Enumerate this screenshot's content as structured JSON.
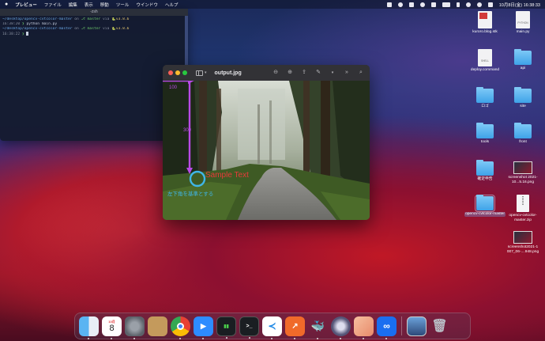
{
  "menubar": {
    "apple": "",
    "app_name": "プレビュー",
    "items": [
      "ファイル",
      "編集",
      "表示",
      "移動",
      "ツール",
      "ウインドウ",
      "ヘルプ"
    ],
    "datetime": "10月8日(金)  16:38:33"
  },
  "terminal": {
    "title": "-zsh",
    "lines": [
      {
        "path": "~/desktop/opencv-cvtcolor-master",
        "on": " on ",
        "branch": "master",
        "via": " via ",
        "py": "v3.8.6"
      },
      {
        "time": "16:38:20",
        "cmd": "python main.py"
      },
      {
        "path": "~/desktop/opencv-cvtcolor-master",
        "on": " on ",
        "branch": "master",
        "via": " via ",
        "py": "v3.8.6"
      },
      {
        "time": "16:38:22",
        "cmd": ""
      }
    ]
  },
  "preview": {
    "title": "output.jpg",
    "overlay": {
      "label_100": "100",
      "label_300": "300",
      "sample_text": "Sample Text",
      "caption": "左下角を基準とする"
    }
  },
  "desktop": {
    "icons": [
      {
        "label": "kuroro.blog.stk",
        "kind": "doc-red"
      },
      {
        "label": "main.py",
        "kind": "doc",
        "tag": "PYTHON"
      },
      {
        "label": "deploy.command",
        "kind": "doc",
        "tag": "SHELL"
      },
      {
        "label": "api",
        "kind": "folder"
      },
      {
        "label": "ロゴ",
        "kind": "folder"
      },
      {
        "label": "site",
        "kind": "folder"
      },
      {
        "label": "tools",
        "kind": "folder"
      },
      {
        "label": "front",
        "kind": "folder"
      },
      {
        "label": "確定申告",
        "kind": "folder"
      },
      {
        "label": "screenshot 2021-10...5.16.png",
        "kind": "shot"
      },
      {
        "label": "opencv-cvtcolor-master",
        "kind": "folder-selected"
      },
      {
        "label": "opencv-cvtcolor-master.zip",
        "kind": "zip"
      },
      {
        "label": "screenshot2021-1 007_06-....948.png",
        "kind": "shot"
      }
    ]
  },
  "dock": {
    "calendar_month": "10月",
    "calendar_day": "8",
    "apps": [
      "finder",
      "calendar",
      "system-preferences",
      "contacts",
      "chrome",
      "zoom",
      "terminal-activity",
      "terminal",
      "vscode",
      "git-tool",
      "docker",
      "disk-utility",
      "preview",
      "infinity-app",
      "downloads",
      "trash"
    ]
  },
  "colors": {
    "overlay_magenta": "#b94ae6",
    "overlay_cyan": "#3fb6e8",
    "overlay_red": "#e83a3a"
  }
}
